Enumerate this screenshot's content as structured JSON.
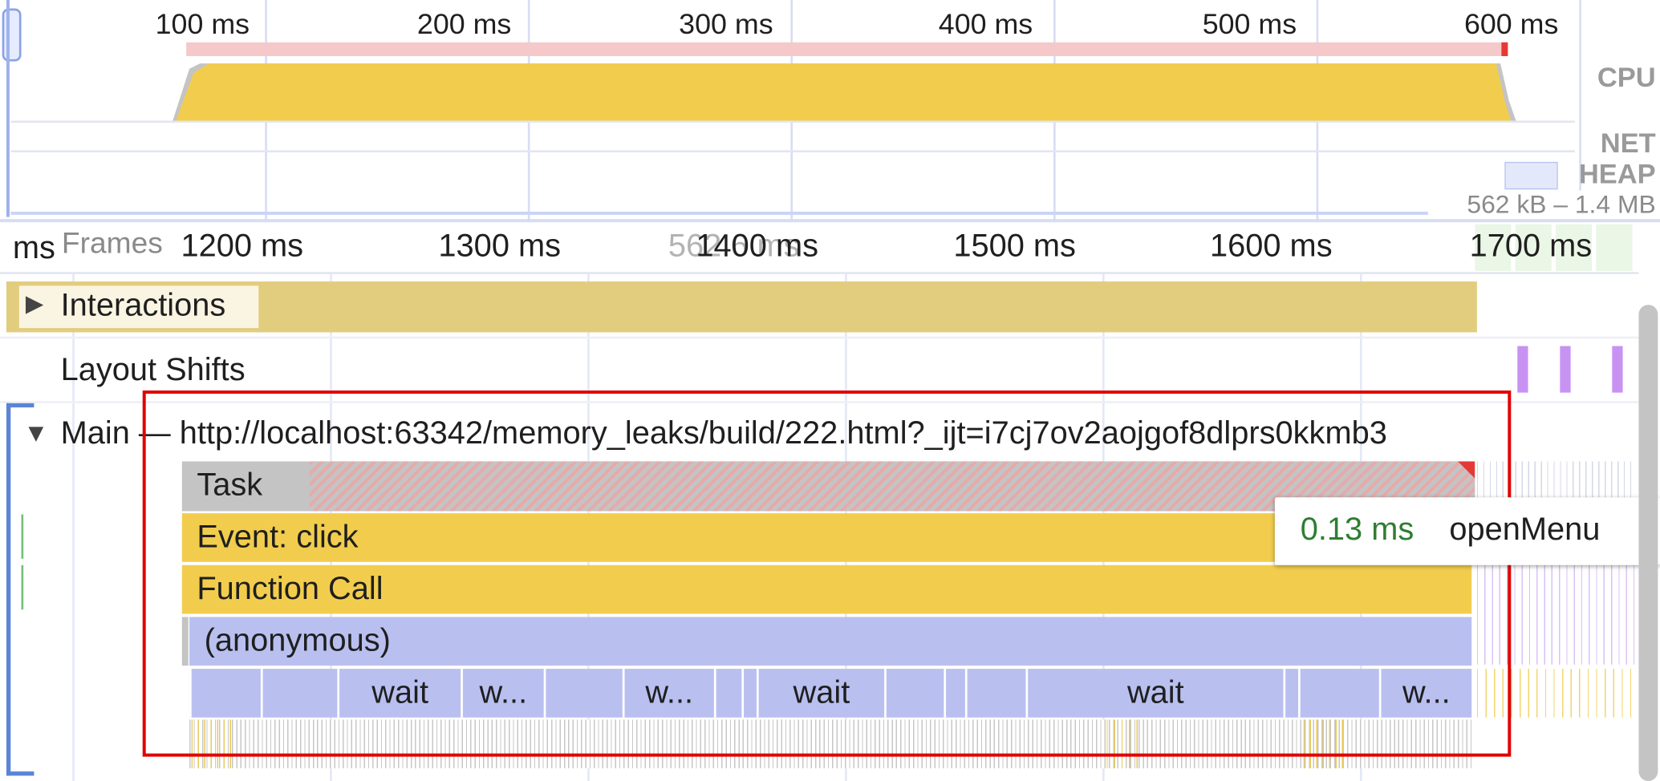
{
  "overview": {
    "ticks": [
      "100 ms",
      "200 ms",
      "300 ms",
      "400 ms",
      "500 ms",
      "600 ms"
    ],
    "labels": {
      "cpu": "CPU",
      "net": "NET",
      "heap": "HEAP"
    },
    "heap_range": "562 kB – 1.4 MB"
  },
  "timeline": {
    "ticks": [
      "1200 ms",
      "1300 ms",
      "1400 ms",
      "1500 ms",
      "1600 ms",
      "1700 ms"
    ],
    "left_fragment": "ms",
    "frames_label": "Frames",
    "ghost_duration": "562.6 ms"
  },
  "tracks": {
    "interactions": "Interactions",
    "layout_shifts": "Layout Shifts",
    "main": "Main — http://localhost:63342/memory_leaks/build/222.html?_ijt=i7cj7ov2aojgof8dlprs0kkmb3"
  },
  "flame": {
    "task": "Task",
    "event": "Event: click",
    "function_call": "Function Call",
    "anonymous": "(anonymous)",
    "waits": [
      "wait",
      "w...",
      "w...",
      "wait",
      "wait",
      "w..."
    ]
  },
  "tooltip": {
    "duration": "0.13 ms",
    "name": "openMenu"
  },
  "colors": {
    "scripting": "#f2cd4d",
    "interaction": "#e2cc7e",
    "js_frame": "#b9c0f0",
    "task_gray": "#c4c4c4",
    "long_task_red": "#e53935",
    "layout_shift": "#c892f2",
    "highlight_box": "#e00000",
    "duration_green": "#2e7d32"
  },
  "icons": {
    "expand": "triangle-right",
    "collapse": "triangle-down"
  }
}
